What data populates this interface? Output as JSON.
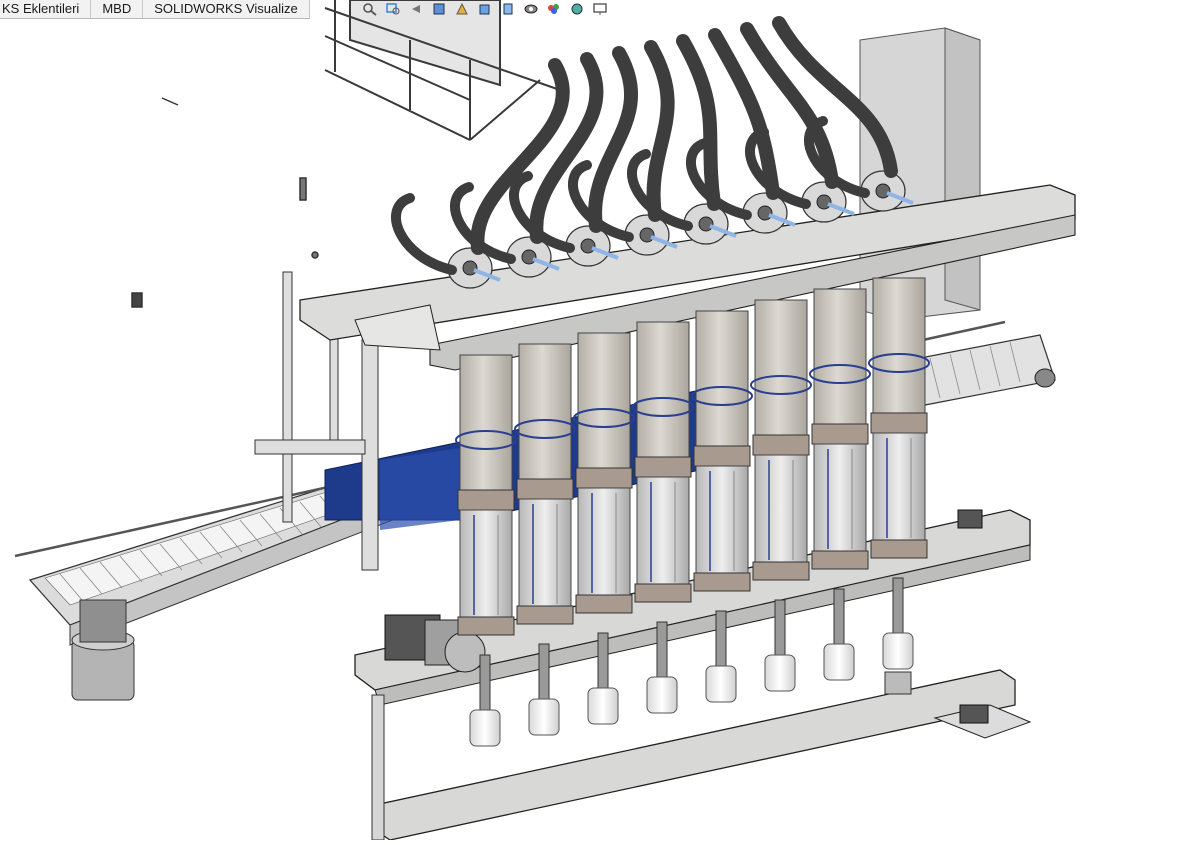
{
  "app": {
    "tabs": [
      {
        "label": "KS Eklentileri"
      },
      {
        "label": "MBD"
      },
      {
        "label": "SOLIDWORKS Visualize"
      }
    ]
  },
  "heads_up_toolbar": {
    "icons": [
      "search-icon",
      "zoom-area-icon",
      "previous-view-icon",
      "section-view-icon",
      "dynamic-annotation-icon",
      "view-orientation-icon",
      "display-style-icon",
      "hide-show-icon",
      "edit-appearance-icon",
      "scene-icon",
      "display-settings-icon"
    ]
  },
  "model": {
    "heads": 8,
    "colors": {
      "frame": "#d4d4d2",
      "frame_edge": "#2e2e2e",
      "cylinder": "#c9c6bf",
      "hose": "#3d3d3d",
      "collar": "#a89a8e",
      "blue_panel": "#1e3a8a",
      "motor": "#a5a5a5"
    }
  }
}
